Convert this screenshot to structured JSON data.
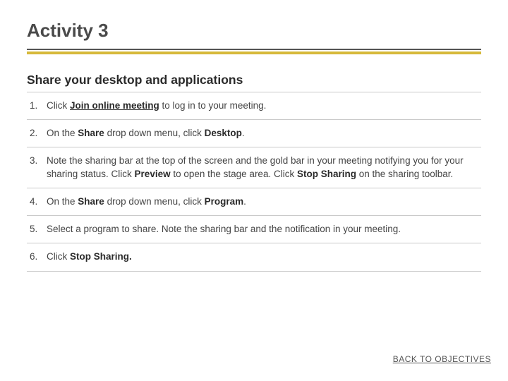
{
  "title": "Activity 3",
  "subtitle": "Share your desktop and applications",
  "steps": {
    "s1_a": "Click ",
    "s1_b": "Join online meeting",
    "s1_c": " to log in to your meeting.",
    "s2_a": "On the ",
    "s2_b": "Share",
    "s2_c": " drop down menu, click ",
    "s2_d": "Desktop",
    "s2_e": ".",
    "s3_a": "Note the sharing bar at the top of the screen and the gold bar in your meeting notifying you for your sharing status. Click ",
    "s3_b": "Preview",
    "s3_c": " to open the stage area. Click ",
    "s3_d": "Stop Sharing",
    "s3_e": " on the sharing toolbar.",
    "s4_a": "On the ",
    "s4_b": "Share",
    "s4_c": " drop down menu, click ",
    "s4_d": "Program",
    "s4_e": ".",
    "s5_a": "Select a program to share. Note the sharing bar and the notification in your meeting.",
    "s6_a": "Click ",
    "s6_b": "Stop Sharing."
  },
  "back_link": "BACK TO OBJECTIVES"
}
